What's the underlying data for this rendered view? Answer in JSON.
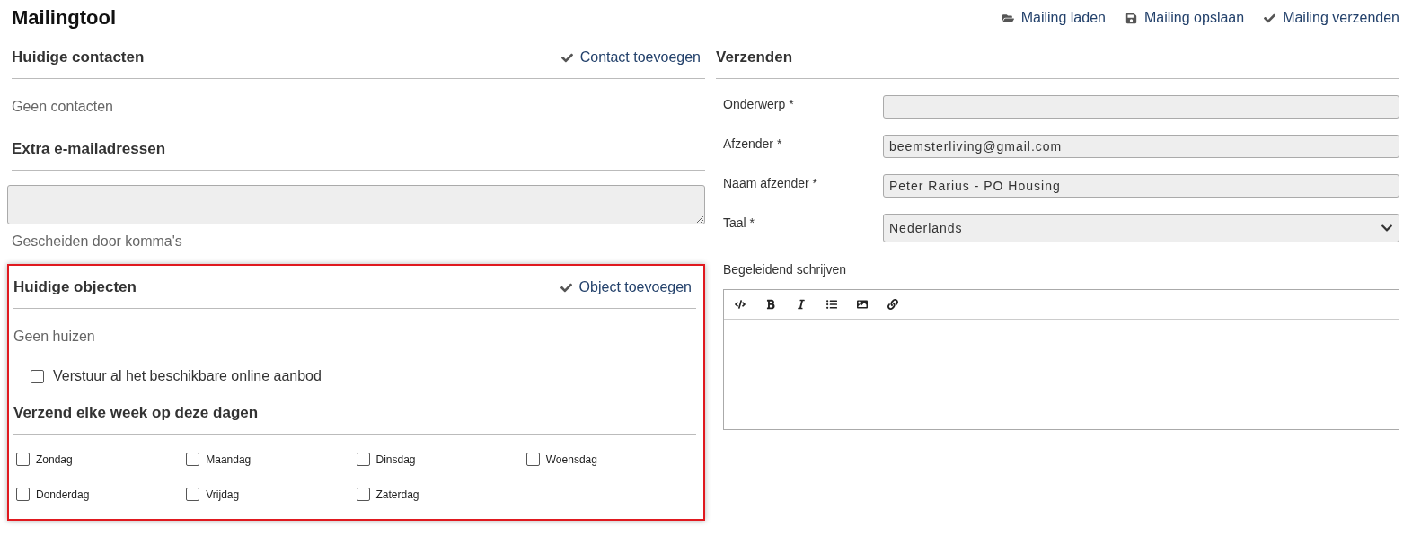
{
  "title": "Mailingtool",
  "actions": [
    {
      "label": "Mailing laden"
    },
    {
      "label": "Mailing opslaan"
    },
    {
      "label": "Mailing verzenden"
    }
  ],
  "contacts": {
    "heading": "Huidige contacten",
    "action": "Contact toevoegen",
    "empty": "Geen contacten"
  },
  "extra": {
    "heading": "Extra e-mailadressen",
    "hint": "Gescheiden door komma's"
  },
  "objects": {
    "highlighted": true,
    "heading": "Huidige objecten",
    "action": "Object toevoegen",
    "empty": "Geen huizen",
    "send_all": {
      "label": "Verstuur al het beschikbare online aanbod",
      "checked": false
    },
    "days_heading": "Verzend elke week op deze dagen",
    "days": [
      {
        "label": "Zondag",
        "checked": false
      },
      {
        "label": "Maandag",
        "checked": false
      },
      {
        "label": "Dinsdag",
        "checked": false
      },
      {
        "label": "Woensdag",
        "checked": false
      },
      {
        "label": "Donderdag",
        "checked": false
      },
      {
        "label": "Vrijdag",
        "checked": false
      },
      {
        "label": "Zaterdag",
        "checked": false
      }
    ]
  },
  "send": {
    "heading": "Verzenden",
    "fields": [
      {
        "kind": "text",
        "label": "Onderwerp *"
      },
      {
        "kind": "text",
        "label": "Afzender *",
        "value": "beemsterliving@gmail.com"
      },
      {
        "kind": "text",
        "label": "Naam afzender *",
        "value": "Peter Rarius - PO Housing"
      },
      {
        "kind": "select",
        "label": "Taal *",
        "value": "Nederlands"
      }
    ],
    "editor_label": "Begeleidend schrijven"
  }
}
